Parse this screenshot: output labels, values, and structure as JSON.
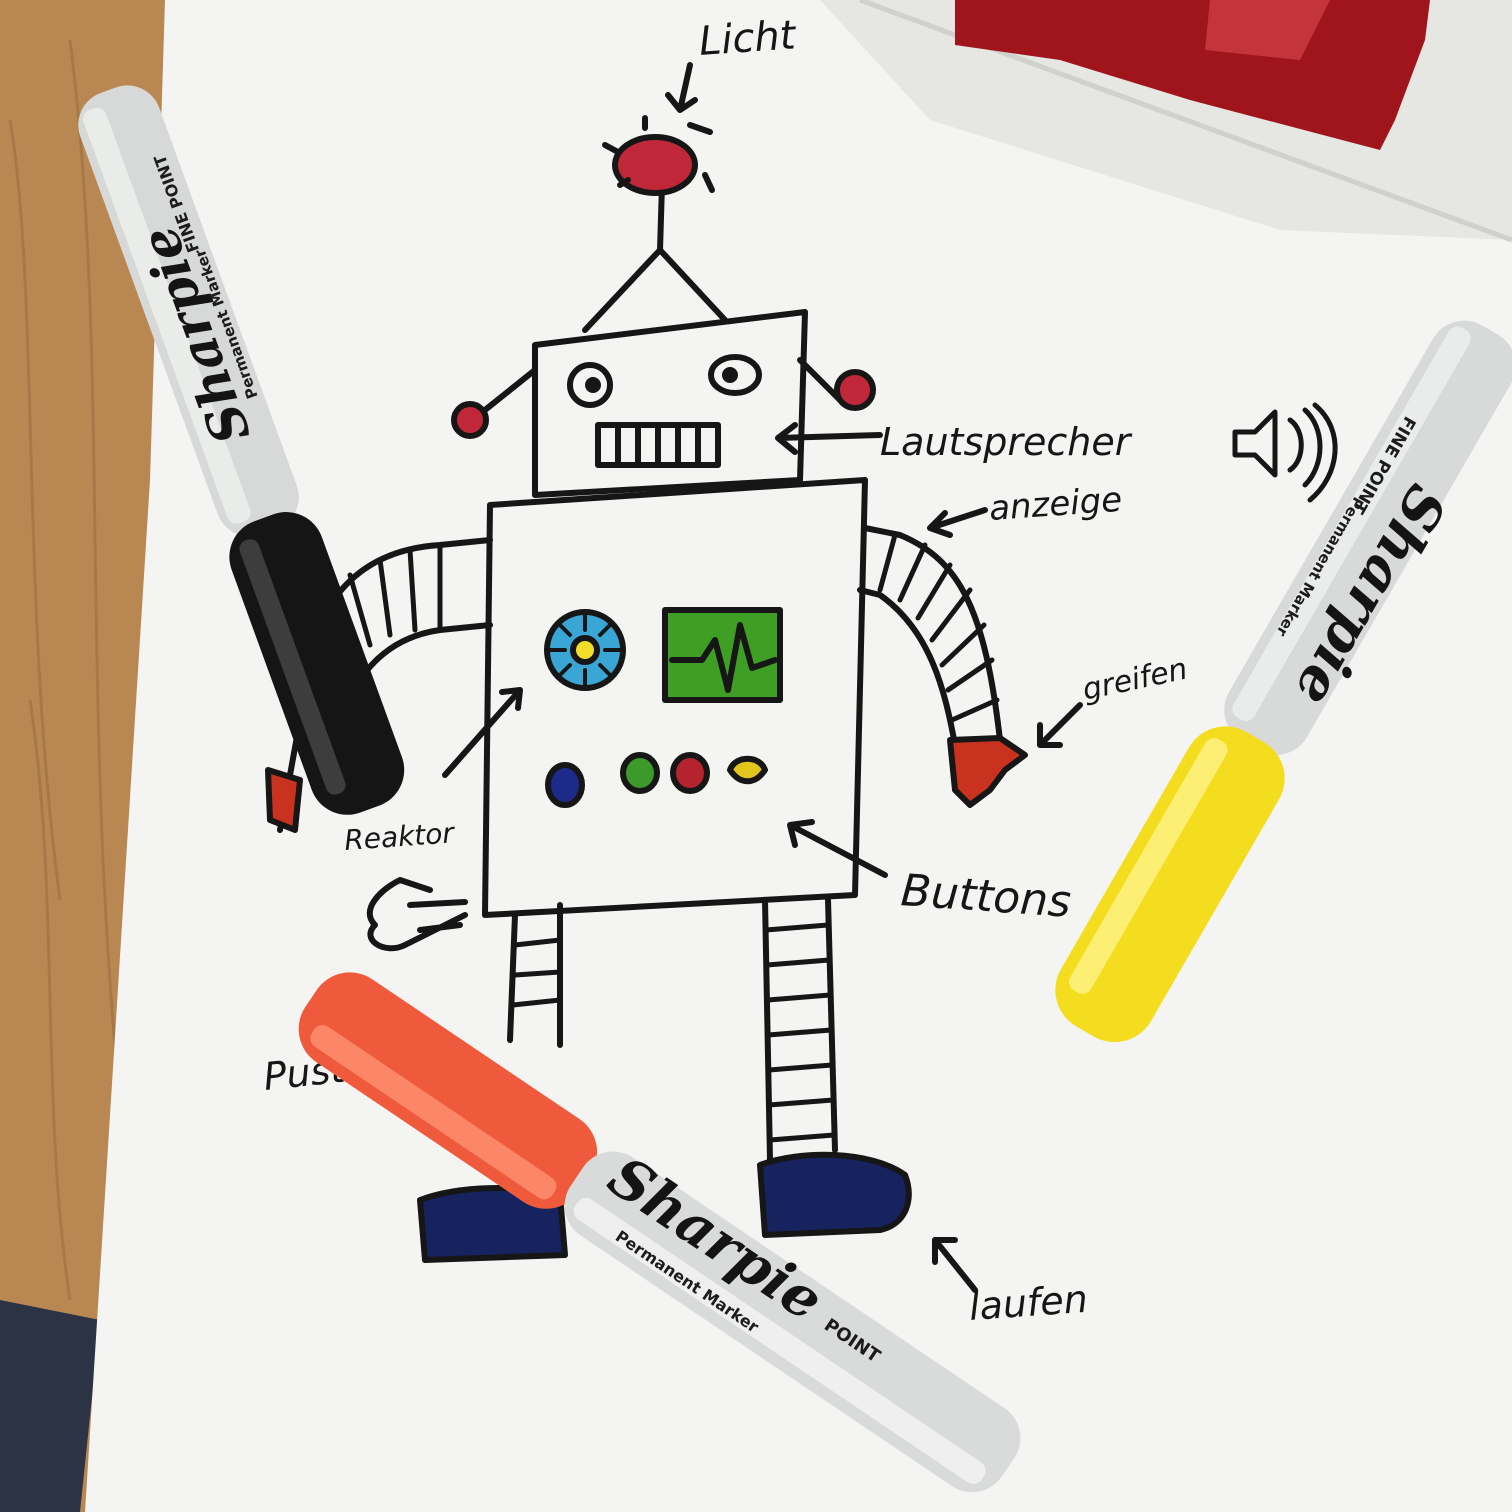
{
  "photo": {
    "subject": "Hand-drawn robot sketch with German annotations surrounded by Sharpie markers",
    "labels": {
      "light": "Licht",
      "speaker": "Lautsprecher",
      "display": "anzeige",
      "grip": "greifen",
      "buttons": "Buttons",
      "sensor": "Reaktor",
      "blow": "Pusten",
      "walk": "laufen"
    },
    "markers": [
      {
        "name": "black-marker",
        "brand": "Sharpie",
        "tip": "FINE POINT",
        "line": "Permanent Marker",
        "cap_color": "#151515"
      },
      {
        "name": "yellow-marker",
        "brand": "Sharpie",
        "tip": "FINE POINT",
        "line": "Permanent Marker",
        "cap_color": "#f4dd1f"
      },
      {
        "name": "red-marker",
        "brand": "Sharpie",
        "tip": "POINT",
        "line": "Permanent Marker",
        "cap_color": "#f05a3c"
      }
    ],
    "colors": {
      "desk": "#b98752",
      "paper": "#f4f4f2",
      "ink": "#161616",
      "robot_light": "#c0283a",
      "screen_green": "#3f9f24",
      "gauge_blue": "#39a6d6",
      "shoe_blue": "#16235f"
    }
  }
}
